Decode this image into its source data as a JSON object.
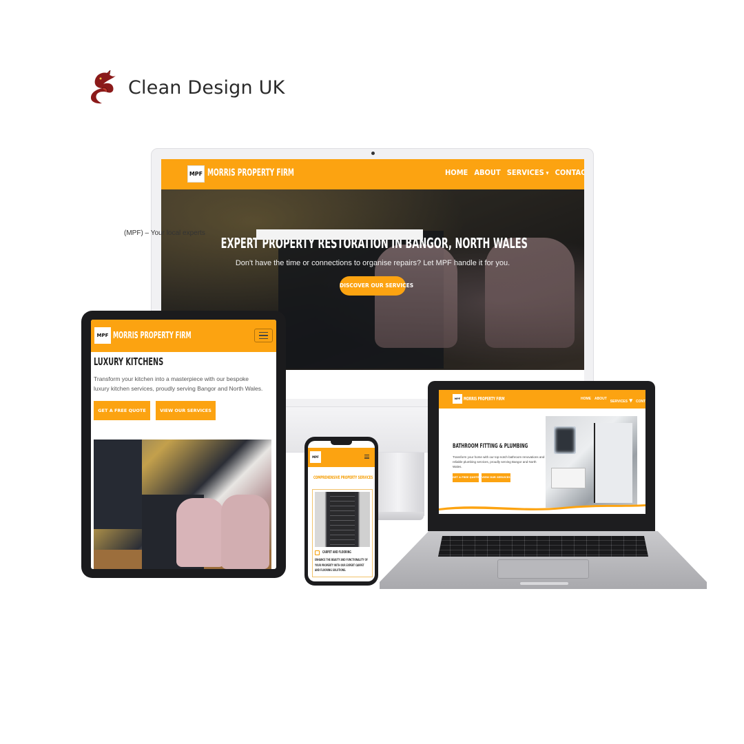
{
  "brand": {
    "name": "Clean Design UK"
  },
  "colors": {
    "accent": "#fca311",
    "text": "#222222",
    "bezel": "#1c1c1e"
  },
  "desktop": {
    "logo_text": "MPF",
    "site_name": "MORRIS PROPERTY FIRM",
    "menu": [
      {
        "label": "HOME"
      },
      {
        "label": "ABOUT"
      },
      {
        "label": "SERVICES"
      },
      {
        "label": "CONTACT"
      }
    ],
    "hero_title": "EXPERT PROPERTY RESTORATION IN BANGOR, NORTH WALES",
    "hero_subtitle": "Don't have the time or connections to organise repairs? Let MPF handle it for you.",
    "hero_button": "DISCOVER OUR SERVICES",
    "footer_text": "(MPF) – Your local experts"
  },
  "tablet": {
    "logo_text": "MPF",
    "site_name": "MORRIS PROPERTY FIRM",
    "menu_icon": "hamburger-icon",
    "title": "LUXURY KITCHENS",
    "text": "Transform your kitchen into a masterpiece with our bespoke luxury kitchen services, proudly serving Bangor and North Wales.",
    "primary_button": "GET A FREE QUOTE",
    "secondary_button": "VIEW OUR SERVICES"
  },
  "phone": {
    "logo_text": "MPF",
    "menu_icon": "hamburger-icon",
    "heading": "COMPREHENSIVE PROPERTY SERVICES",
    "card_title": "CARPET AND FLOORING",
    "card_text": "ENHANCE THE BEAUTY AND FUNCTIONALITY OF YOUR PROPERTY WITH OUR EXPERT CARPET AND FLOORING SOLUTIONS."
  },
  "laptop": {
    "logo_text": "MPF",
    "site_name": "MORRIS PROPERTY FIRM",
    "menu": [
      {
        "label": "HOME"
      },
      {
        "label": "ABOUT"
      },
      {
        "label": "SERVICES"
      },
      {
        "label": "CONTACT"
      }
    ],
    "title": "BATHROOM FITTING & PLUMBING",
    "text": "Transform your home with our top-notch bathroom renovations and reliable plumbing services, proudly serving Bangor and North Wales.",
    "primary_button": "GET A FREE QUOTE",
    "secondary_button": "VIEW OUR SERVICES"
  }
}
